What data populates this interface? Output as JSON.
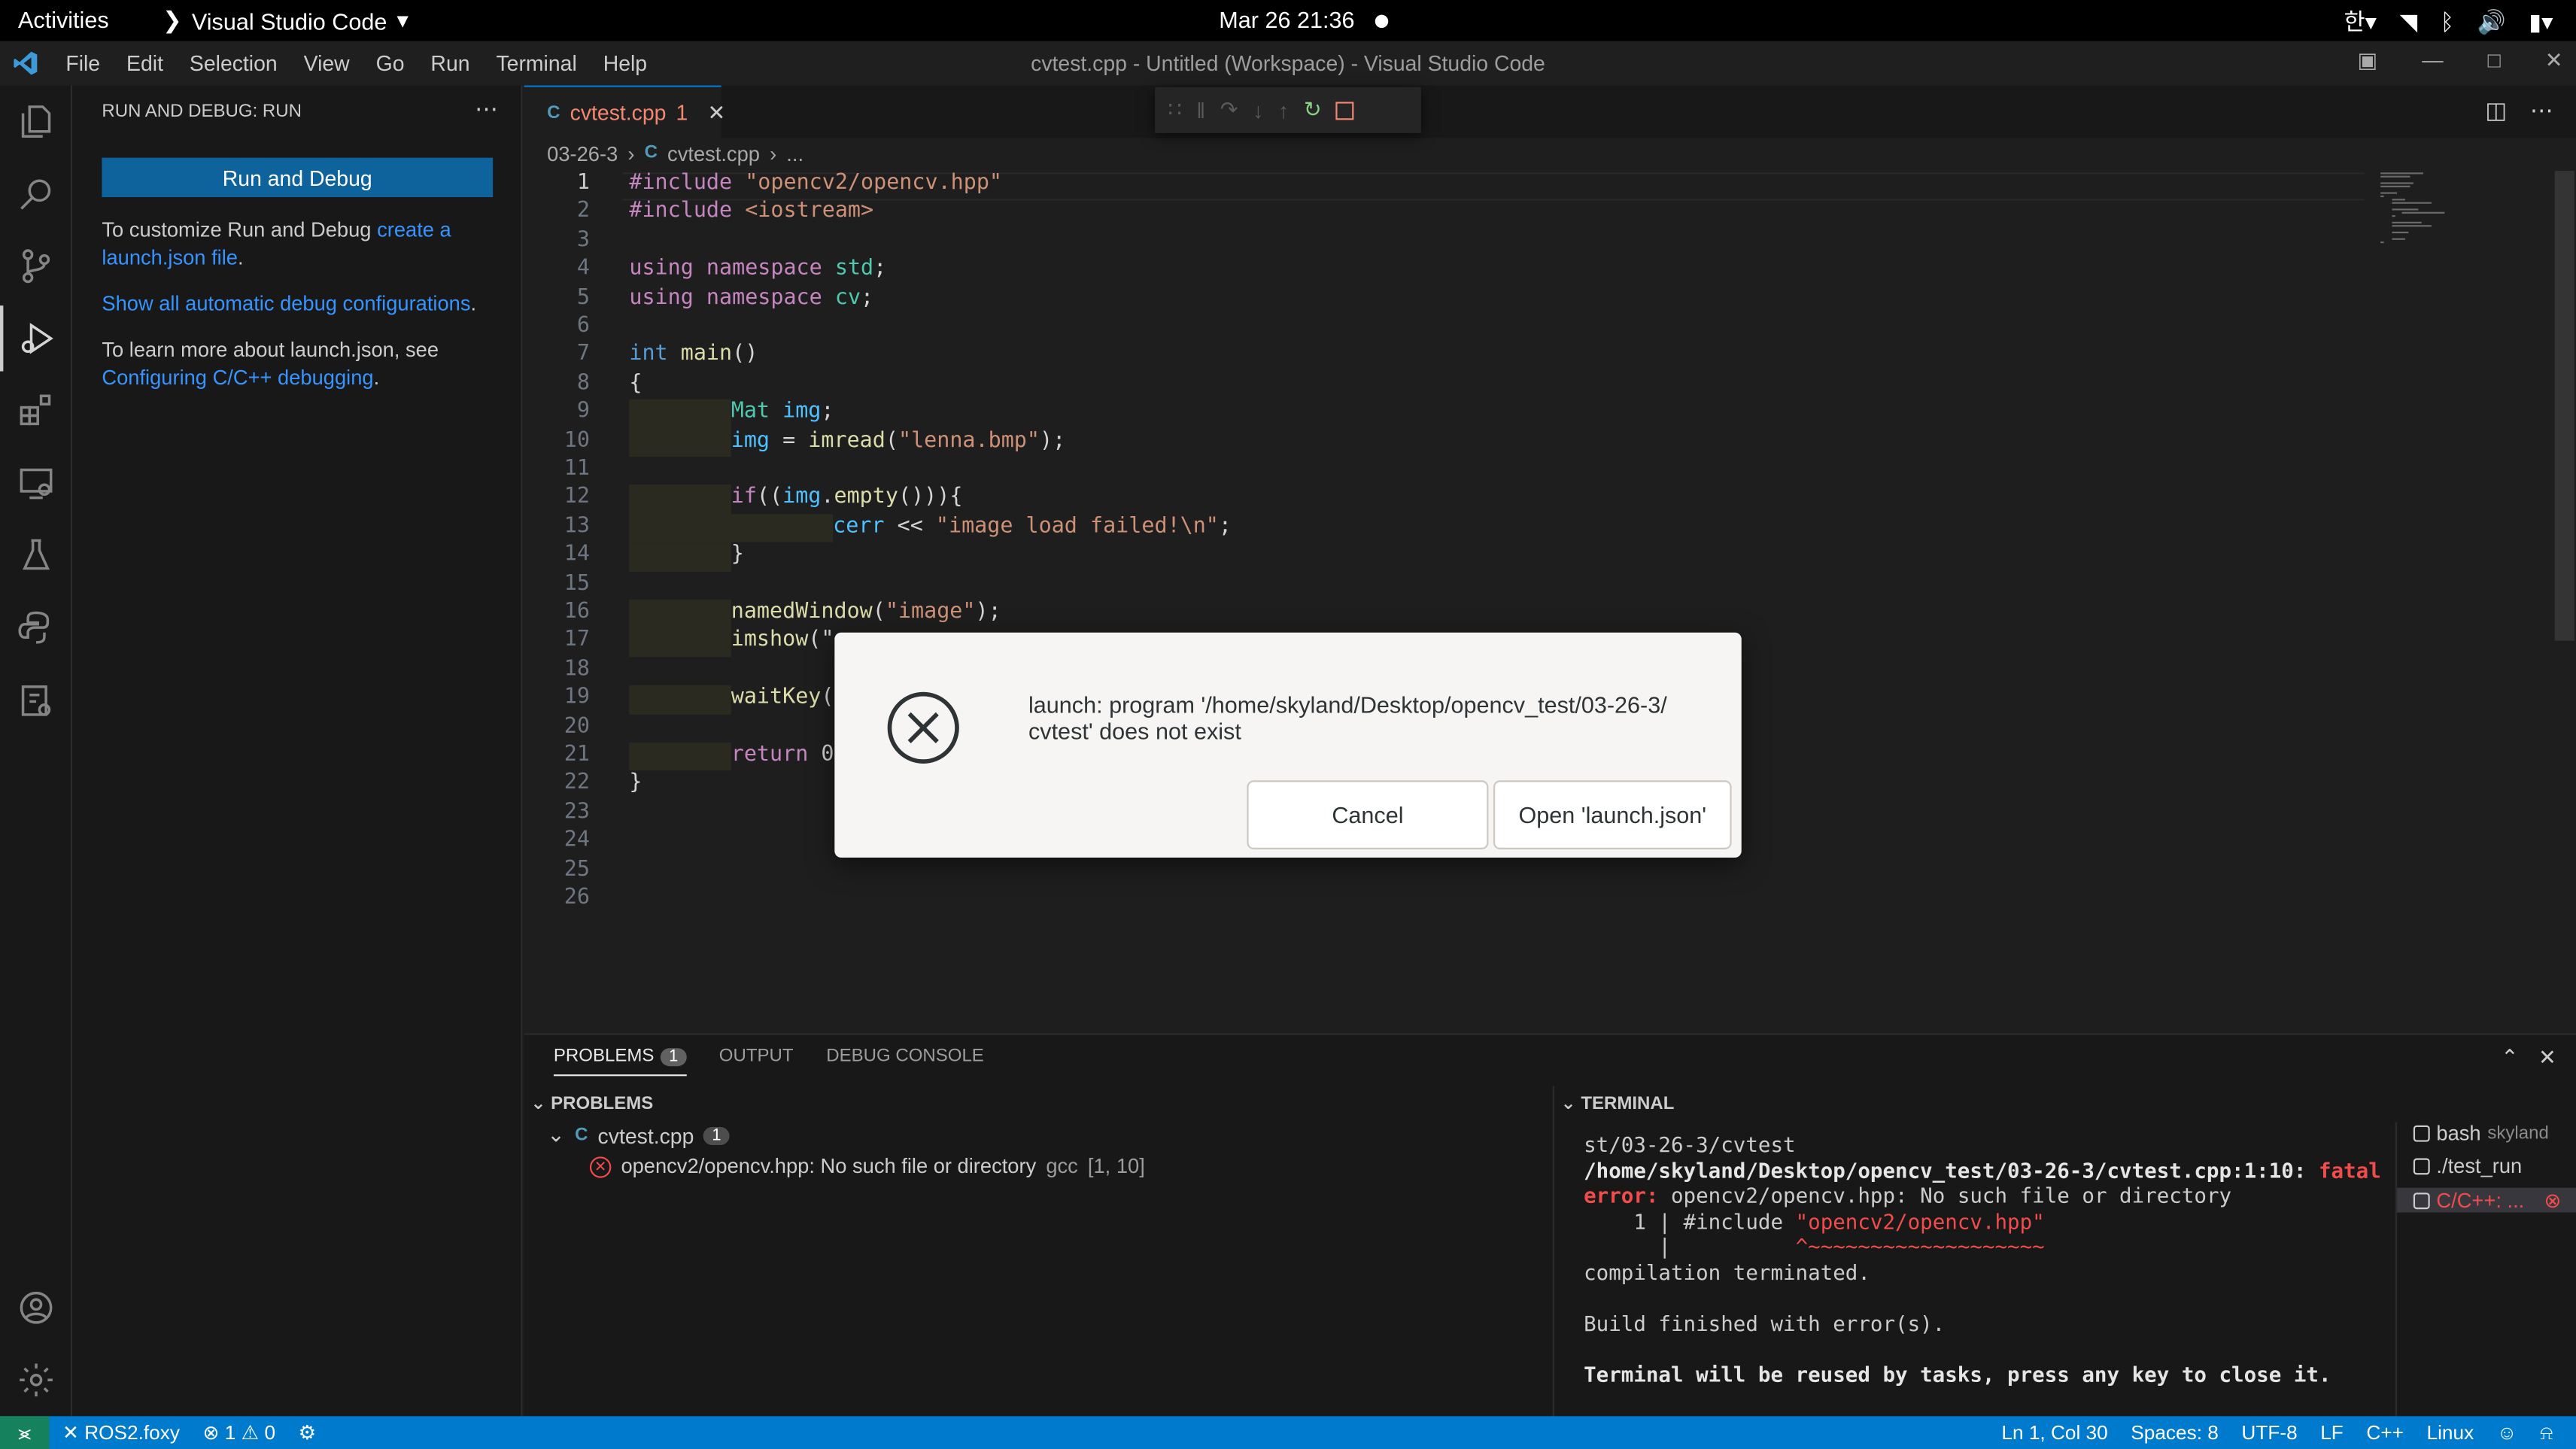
{
  "gnome": {
    "activities": "Activities",
    "app_name": "Visual Studio Code",
    "clock": "Mar 26  21:36"
  },
  "titlebar": {
    "menu": [
      "File",
      "Edit",
      "Selection",
      "View",
      "Go",
      "Run",
      "Terminal",
      "Help"
    ],
    "title": "cvtest.cpp - Untitled (Workspace) - Visual Studio Code"
  },
  "sidebar": {
    "title": "RUN AND DEBUG: RUN",
    "run_button": "Run and Debug",
    "text1_prefix": "To customize Run and Debug ",
    "text1_link": "create a launch.json file",
    "text1_suffix": ".",
    "show_all_link": "Show all automatic debug configurations",
    "text2_prefix": "To learn more about launch.json, see ",
    "text2_link": "Configuring C/C++ debugging",
    "text2_suffix": "."
  },
  "editor": {
    "tab_label": "cvtest.cpp",
    "tab_problems": "1",
    "breadcrumb_folder": "03-26-3",
    "breadcrumb_file": "cvtest.cpp",
    "breadcrumb_more": "..."
  },
  "code_lines": [
    "#include \"opencv2/opencv.hpp\"",
    "#include <iostream>",
    "",
    "using namespace std;",
    "using namespace cv;",
    "",
    "int main()",
    "{",
    "Mat img;",
    "img = imread(\"lenna.bmp\");",
    "",
    "if((img.empty())){",
    "cerr << \"image load failed!\\n\";",
    "}",
    "",
    "namedWindow(\"image\");",
    "imshow(\"",
    "",
    "waitKey(",
    "",
    "return 0",
    "}",
    "",
    "",
    "",
    ""
  ],
  "panel": {
    "tabs": [
      "PROBLEMS",
      "OUTPUT",
      "DEBUG CONSOLE"
    ],
    "problems_count": "1",
    "problems_header": "PROBLEMS",
    "problem_file": "cvtest.cpp",
    "problem_file_count": "1",
    "problem_message": "opencv2/opencv.hpp: No such file or directory",
    "problem_source": "gcc",
    "problem_location": "[1, 10]",
    "terminal_header": "TERMINAL"
  },
  "terminal": {
    "line1": "st/03-26-3/cvtest",
    "line2_path": "/home/skyland/Desktop/opencv_test/03-26-3/cvtest.cpp:1:10:",
    "line2_fatal": " fatal",
    "line3_error": "error:",
    "line3_msg": " opencv2/opencv.hpp: No such file or directory",
    "line4_prefix": "    1 | #include ",
    "line4_include": "\"opencv2/opencv.hpp\"",
    "line5_prefix": "      |          ",
    "line5_caret": "^~~~~~~~~~~~~~~~~~~~",
    "line6": "compilation terminated.",
    "line7": "Build finished with error(s).",
    "line8": "Terminal will be reused by tasks, press any key to close it.",
    "list": [
      {
        "name": "bash",
        "detail": "skyland"
      },
      {
        "name": "./test_run",
        "detail": ""
      },
      {
        "name": "C/C++: ...",
        "detail": ""
      }
    ]
  },
  "statusbar": {
    "remote": "ROS2.foxy",
    "errors": "1",
    "warnings": "0",
    "position": "Ln 1, Col 30",
    "spaces": "Spaces: 8",
    "encoding": "UTF-8",
    "eol": "LF",
    "language": "C++",
    "platform": "Linux"
  },
  "dialog": {
    "message": "launch: program '/home/skyland/Desktop/opencv_test/03-26-3/ cvtest' does not exist",
    "cancel": "Cancel",
    "open": "Open 'launch.json'"
  }
}
